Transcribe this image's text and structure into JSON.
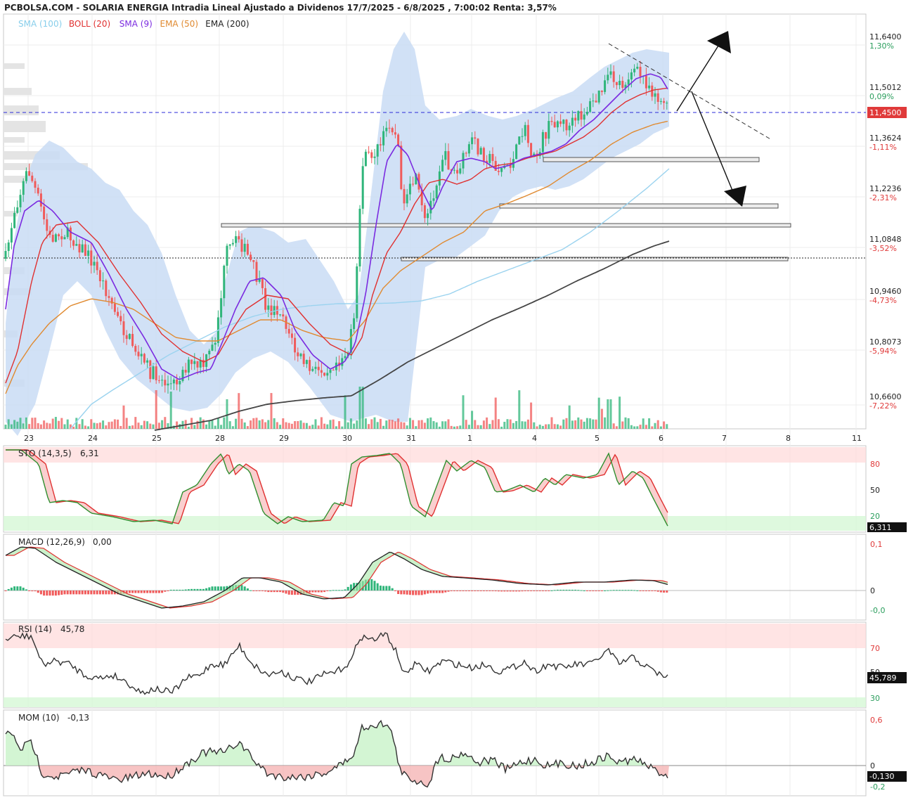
{
  "title": "PCBOLSA.COM - SOLARIA ENERGIA Intradia Lineal Ajustado a Dividenos 17/7/2025 - 6/8/2025 , 7:00:02 Renta: 3,57%",
  "legend": [
    {
      "label": "SMA (100)",
      "color": "#87ceeb"
    },
    {
      "label": "BOLL (20)",
      "color": "#e03030"
    },
    {
      "label": "SMA (9)",
      "color": "#7b2be0"
    },
    {
      "label": "EMA (50)",
      "color": "#e08a30"
    },
    {
      "label": "EMA (200)",
      "color": "#222222"
    }
  ],
  "colors": {
    "up": "#2fb57a",
    "down": "#f05a5a",
    "band_fill": "#cfe0f5",
    "last_price": "#e03a3a"
  },
  "price_axis": [
    {
      "value": "11,6400",
      "pct": "1,30%",
      "pct_color": "#2a9d5c"
    },
    {
      "value": "11,5012",
      "pct": "0,09%",
      "pct_color": "#2a9d5c"
    },
    {
      "value": "11,3624",
      "pct": "-1,11%",
      "pct_color": "#e03a3a"
    },
    {
      "value": "11,2236",
      "pct": "-2,31%",
      "pct_color": "#e03a3a"
    },
    {
      "value": "11,0848",
      "pct": "-3,52%",
      "pct_color": "#e03a3a"
    },
    {
      "value": "10,9460",
      "pct": "-4,73%",
      "pct_color": "#e03a3a"
    },
    {
      "value": "10,8073",
      "pct": "-5,94%",
      "pct_color": "#e03a3a"
    },
    {
      "value": "10,6600",
      "pct": "-7,22%",
      "pct_color": "#e03a3a"
    }
  ],
  "last_price": "11,4500",
  "x_labels": [
    "23",
    "24",
    "25",
    "28",
    "29",
    "30",
    "31",
    "1",
    "4",
    "5",
    "6",
    "7",
    "8",
    "11"
  ],
  "panels": {
    "sto": {
      "label": "STO (14,3,5)",
      "value": "6,31",
      "ticks": [
        "80",
        "50",
        "20"
      ],
      "last": "6,311"
    },
    "macd": {
      "label": "MACD (12,26,9)",
      "value": "0,00",
      "ticks": [
        "0,1",
        "0",
        "-0,0"
      ]
    },
    "rsi": {
      "label": "RSI (14)",
      "value": "45,78",
      "ticks": [
        "70",
        "50",
        "30"
      ],
      "last": "45,789"
    },
    "mom": {
      "label": "MOM (10)",
      "value": "-0,13",
      "ticks": [
        "0,6",
        "0",
        "-0,2"
      ],
      "last": "-0,130"
    }
  },
  "chart_data": {
    "type": "candlestick",
    "title": "SOLARIA ENERGIA Intradia Lineal Ajustado a Dividenos 17/7/2025 - 6/8/2025",
    "sessions": [
      "23",
      "24",
      "25",
      "28",
      "29",
      "30",
      "31",
      "1",
      "4",
      "5",
      "6"
    ],
    "approx_session_close": [
      11.05,
      10.98,
      10.76,
      10.99,
      10.92,
      11.33,
      11.2,
      11.4,
      11.38,
      11.5,
      11.45
    ],
    "y_range": [
      10.6,
      11.71
    ],
    "last": 11.45,
    "indicators": [
      "SMA (100)",
      "BOLL (20)",
      "SMA (9)",
      "EMA (50)",
      "EMA (200)"
    ],
    "sto_last": 6.311,
    "macd_last": 0.0,
    "rsi_last": 45.789,
    "mom_last": -0.13
  }
}
